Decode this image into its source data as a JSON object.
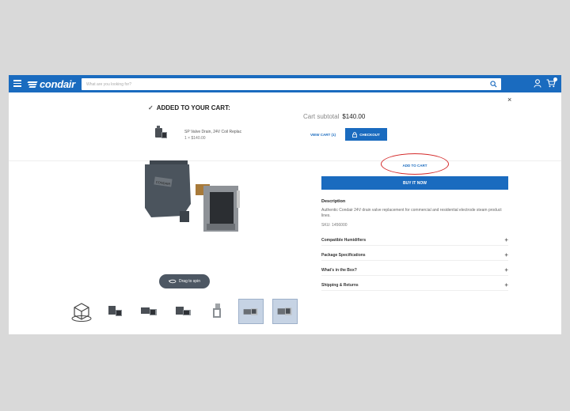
{
  "header": {
    "brand": "condair",
    "search_placeholder": "What are you looking for?"
  },
  "cart_popup": {
    "title": "ADDED TO YOUR CART:",
    "item_name": "SP Valve Drain, 24V Coil Replac",
    "item_qty_price": "1 × $140.00",
    "subtotal_label": "Cart subtotal",
    "subtotal_value": "$140.00",
    "view_cart_label": "VIEW CART (1)",
    "checkout_label": "CHECKOUT",
    "close_glyph": "×"
  },
  "product": {
    "add_to_cart_label": "ADD TO CART",
    "buy_now_label": "BUY IT NOW",
    "description_title": "Description",
    "description_text": "Authentic Condair 24V drain valve replacement for commercial and residential electrode steam product lines.",
    "sku": "SKU: 1456000",
    "accordion": [
      {
        "label": "Compatible Humidifiers",
        "icon": "+"
      },
      {
        "label": "Package Specifications",
        "icon": "+"
      },
      {
        "label": "What's in the Box?",
        "icon": "+"
      },
      {
        "label": "Shipping & Returns",
        "icon": "+"
      }
    ],
    "drag_to_spin_label": "Drag to spin"
  },
  "colors": {
    "brand_blue": "#1a6bbf",
    "highlight_red": "#d42a2a",
    "pill_grey": "#4d5763"
  },
  "icons": [
    "hamburger-icon",
    "search-icon",
    "user-icon",
    "cart-icon",
    "check-icon",
    "lock-icon",
    "rotate-icon",
    "plus-icon"
  ]
}
